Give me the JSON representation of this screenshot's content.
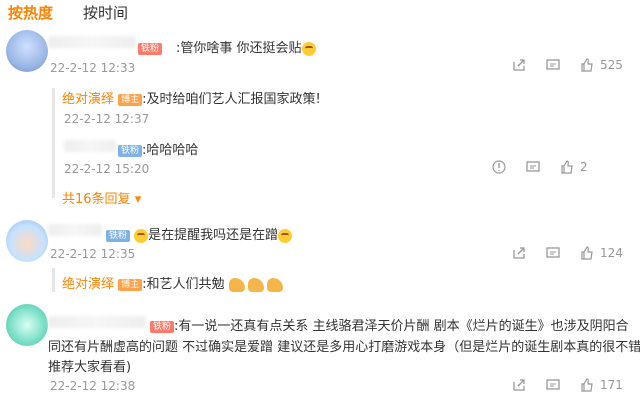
{
  "tabs": {
    "hot": "按热度",
    "time": "按时间"
  },
  "comments": [
    {
      "badge": "铁粉",
      "text": ":管你啥事 你还挺会贴",
      "time": "22-2-12 12:33",
      "likes": "525",
      "replies": [
        {
          "name": "绝对演绎",
          "badge": "博主",
          "text": ":及时给咱们艺人汇报国家政策!",
          "time": "22-2-12 12:37"
        },
        {
          "badge": "铁粉",
          "text": ":哈哈哈哈",
          "time": "22-2-12 15:20",
          "likes": "2"
        }
      ],
      "more": "共16条回复"
    },
    {
      "badge": "铁粉",
      "text": "是在提醒我吗还是在蹭",
      "time": "22-2-12 12:35",
      "likes": "124",
      "replies": [
        {
          "name": "绝对演绎",
          "badge": "博主",
          "text": ":和艺人们共勉"
        }
      ]
    },
    {
      "badge": "铁粉",
      "line1": ":有一说一还真有点关系 主线骆君泽天价片酬 剧本《烂片的诞生》也涉及阴阳合",
      "line2": "同还有片酬虚高的问题 不过确实是爱蹭 建议还是多用心打磨游戏本身（但是烂片的诞生剧本真的很不错",
      "line3": "推荐大家看看)",
      "time": "22-2-12 12:38",
      "likes": "171"
    }
  ],
  "colors": {
    "accent": "#ff8200",
    "muted": "#999999"
  }
}
